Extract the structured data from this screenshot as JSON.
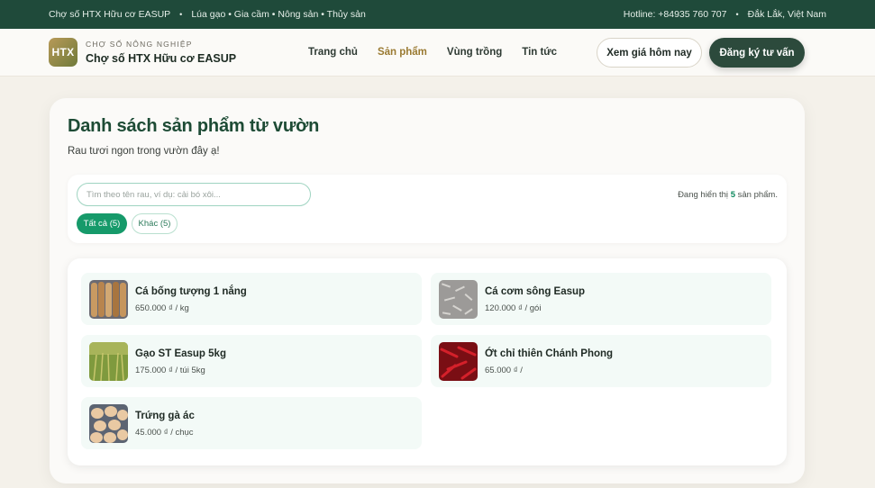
{
  "topbar": {
    "name": "Chợ số HTX Hữu cơ EASUP",
    "tags": "Lúa gạo • Gia cầm • Nông sản • Thủy sản",
    "hotline": "Hotline: +84935 760 707",
    "location": "Đắk Lắk, Việt Nam",
    "separator": "•"
  },
  "header": {
    "logo_text": "HTX",
    "kicker": "CHỢ SỐ NÔNG NGHIỆP",
    "brand_name": "Chợ số HTX Hữu cơ EASUP",
    "nav": [
      {
        "label": "Trang chủ"
      },
      {
        "label": "Sản phẩm"
      },
      {
        "label": "Vùng trồng"
      },
      {
        "label": "Tin tức"
      }
    ],
    "price_button": "Xem giá hôm nay",
    "register_button": "Đăng ký tư vấn"
  },
  "main": {
    "title": "Danh sách sản phẩm từ vườn",
    "subtitle": "Rau tươi ngon trong vườn đây ạ!",
    "search_placeholder": "Tìm theo tên rau, ví dụ: cải bó xôi...",
    "count_prefix": "Đang hiển thị",
    "count_value": "5",
    "count_suffix": "sản phẩm.",
    "chips": [
      {
        "label": "Tất cả (5)"
      },
      {
        "label": "Khác (5)"
      }
    ],
    "products": [
      {
        "name": "Cá bống tượng 1 nắng",
        "price": "650.000 ₫ / kg",
        "icon": "dried-fish-image"
      },
      {
        "name": "Cá cơm sông Easup",
        "price": "120.000 ₫ / gói",
        "icon": "anchovy-image"
      },
      {
        "name": "Gạo ST Easup 5kg",
        "price": "175.000 ₫ / túi 5kg",
        "icon": "rice-field-image"
      },
      {
        "name": "Ớt chỉ thiên Chánh Phong",
        "price": "65.000 ₫ /",
        "icon": "chili-image"
      },
      {
        "name": "Trứng gà ác",
        "price": "45.000 ₫ / chục",
        "icon": "eggs-image"
      }
    ]
  },
  "colors": {
    "topbar_bg": "#1f4a3a",
    "accent_green": "#169a6a",
    "title_green": "#1d4b35",
    "nav_active": "#9a7a32",
    "dark_button": "#2c4a3c"
  }
}
